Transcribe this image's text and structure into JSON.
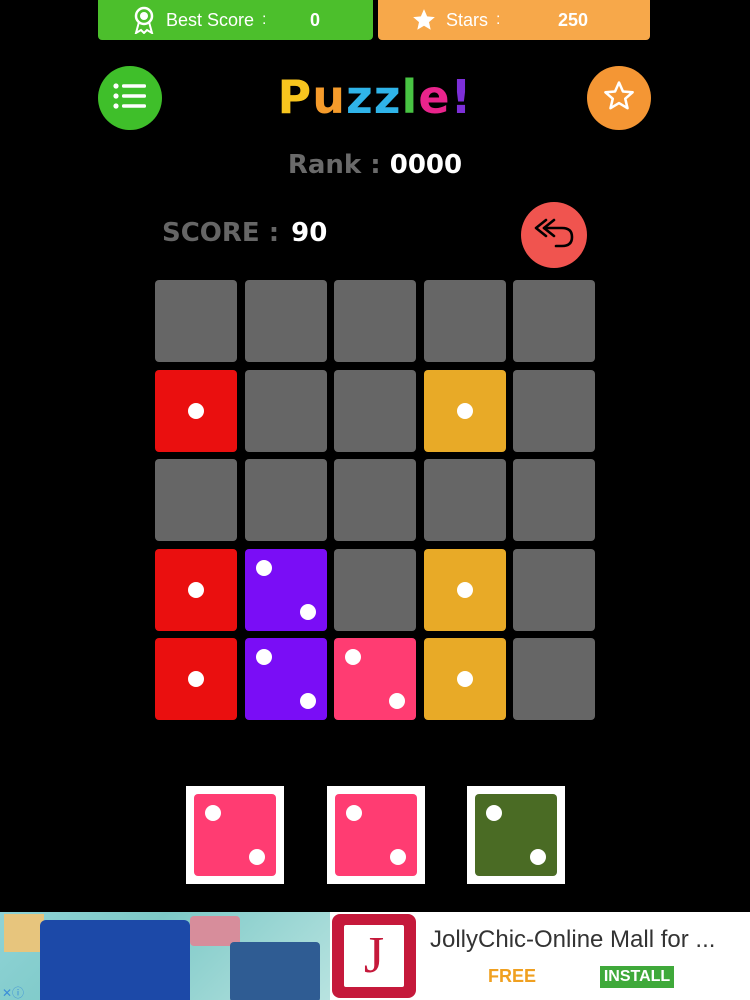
{
  "topbar": {
    "best_score_label": "Best Score",
    "best_score_sep": ":",
    "best_score_value": "0",
    "stars_label": "Stars",
    "stars_sep": ":",
    "stars_value": "250"
  },
  "title": {
    "letters": [
      "P",
      "u",
      "z",
      "z",
      "l",
      "e",
      "!"
    ],
    "colors": [
      "#f7c51e",
      "#f59b2b",
      "#2fb4e9",
      "#2fb4e9",
      "#48c443",
      "#e9248c",
      "#7d2fd8"
    ]
  },
  "rank": {
    "label": "Rank :",
    "value": "0000"
  },
  "score": {
    "label": "SCORE :",
    "value": "90"
  },
  "icons": {
    "best_score": "medal-icon",
    "stars": "star-icon",
    "menu": "menu-list-icon",
    "favorite": "star-outline-icon",
    "undo": "undo-double-arrow-icon"
  },
  "colors": {
    "empty": "#666666",
    "red": "#ea0f0f",
    "orange": "#e8aa27",
    "purple": "#7a0df6",
    "pink": "#ff3c72",
    "green": "#4a6b24"
  },
  "board": [
    [
      0,
      0,
      0,
      0,
      0
    ],
    [
      1,
      0,
      0,
      1,
      0
    ],
    [
      0,
      0,
      0,
      0,
      0
    ],
    [
      1,
      2,
      0,
      1,
      0
    ],
    [
      1,
      2,
      2,
      1,
      0
    ]
  ],
  "board_colors": [
    [
      "empty",
      "empty",
      "empty",
      "empty",
      "empty"
    ],
    [
      "red",
      "empty",
      "empty",
      "orange",
      "empty"
    ],
    [
      "empty",
      "empty",
      "empty",
      "empty",
      "empty"
    ],
    [
      "red",
      "purple",
      "empty",
      "orange",
      "empty"
    ],
    [
      "red",
      "purple",
      "pink",
      "orange",
      "empty"
    ]
  ],
  "tray": [
    {
      "color": "pink",
      "pips": 2
    },
    {
      "color": "pink",
      "pips": 2
    },
    {
      "color": "green",
      "pips": 2
    }
  ],
  "ad": {
    "logo_letter": "J",
    "title": "JollyChic-Online Mall for ...",
    "free_label": "FREE",
    "install_label": "INSTALL",
    "close_glyph": "✕ⓘ"
  }
}
